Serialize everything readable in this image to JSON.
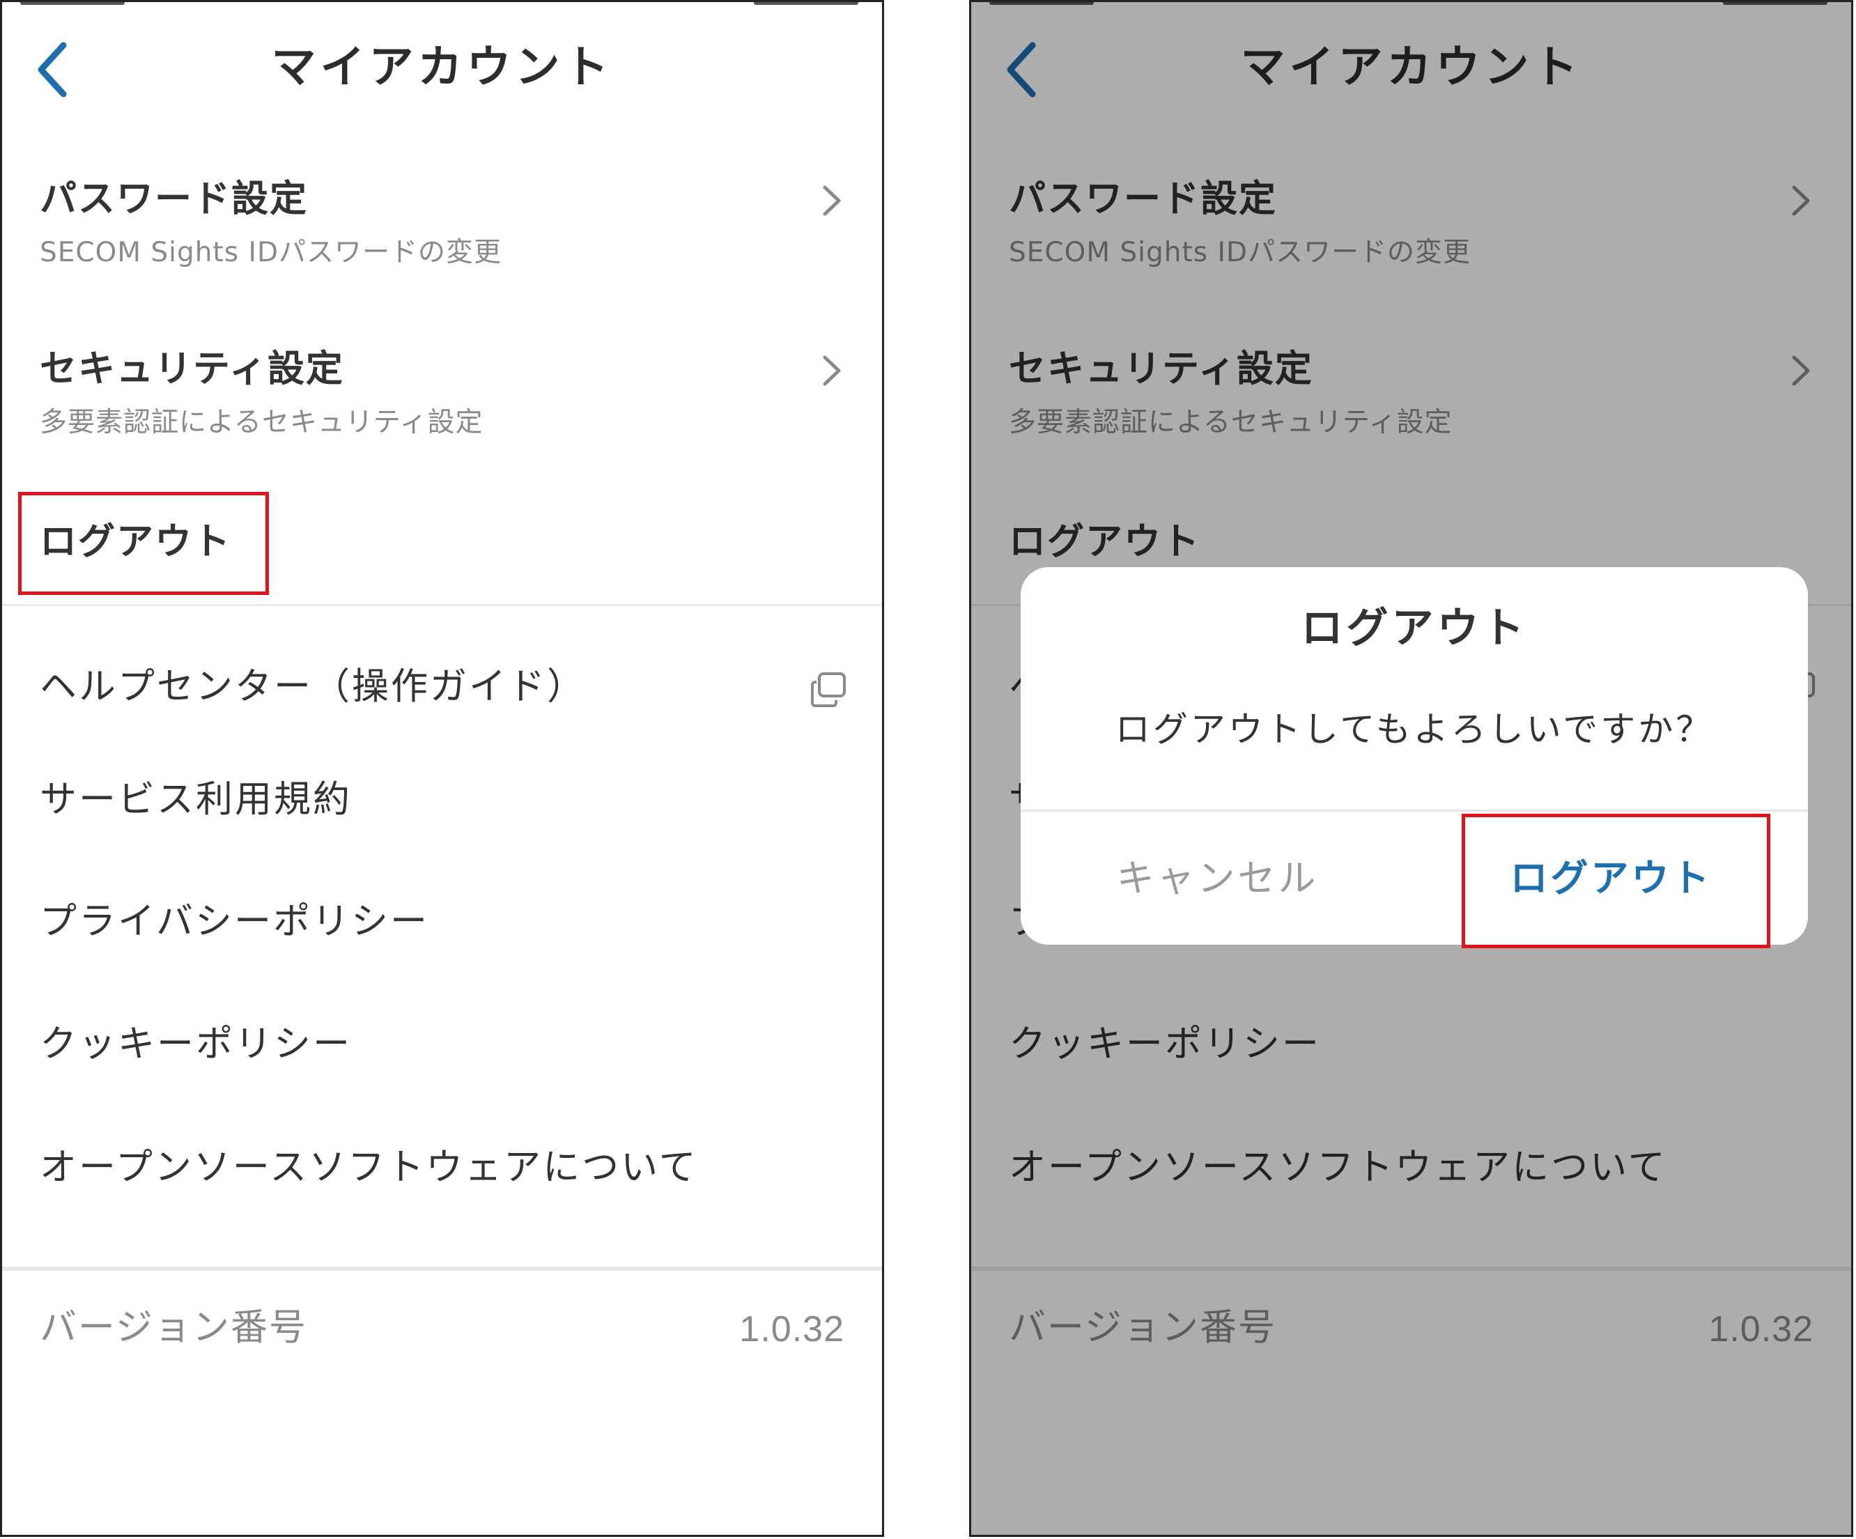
{
  "nav": {
    "title": "マイアカウント"
  },
  "menu": {
    "password": {
      "title": "パスワード設定",
      "subtitle": "SECOM Sights IDパスワードの変更"
    },
    "security": {
      "title": "セキュリティ設定",
      "subtitle": "多要素認証によるセキュリティ設定"
    },
    "logout": {
      "title": "ログアウト"
    },
    "links": [
      {
        "label": "ヘルプセンター（操作ガイド）"
      },
      {
        "label": "サービス利用規約"
      },
      {
        "label": "プライバシーポリシー"
      },
      {
        "label": "クッキーポリシー"
      },
      {
        "label": "オープンソースソフトウェアについて"
      }
    ]
  },
  "version": {
    "label": "バージョン番号",
    "value": "1.0.32"
  },
  "dialog": {
    "title": "ログアウト",
    "message": "ログアウトしてもよろしいですか？",
    "cancel_label": "キャンセル",
    "confirm_label": "ログアウト"
  },
  "colors": {
    "accent": "#1d6fb2",
    "highlight": "#e3131c",
    "overlay": "rgba(0,0,0,0.32)"
  },
  "icons": {
    "back": "chevron-left-icon",
    "row_arrow": "chevron-right-icon",
    "external": "external-link-icon"
  }
}
